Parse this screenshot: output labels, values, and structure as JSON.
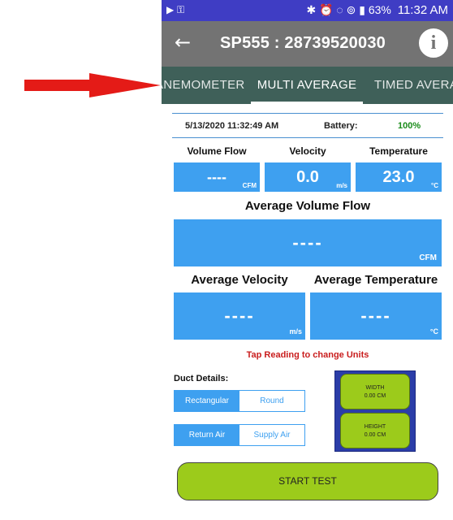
{
  "status_bar": {
    "time": "11:32 AM",
    "battery": "63%",
    "left_icons": "▶ ⚿",
    "right_icons": "✱ ⏰ ◌ ⊚ ▮"
  },
  "app_bar": {
    "title": "SP555 : 28739520030",
    "back_icon": "arrow-left-icon",
    "info_icon": "i"
  },
  "tabs": [
    {
      "label": "ANEMOMETER"
    },
    {
      "label": "MULTI AVERAGE",
      "selected": true
    },
    {
      "label": "TIMED AVERAGE"
    }
  ],
  "info": {
    "datetime": "5/13/2020 11:32:49 AM",
    "battery_label": "Battery:",
    "battery_value": "100%",
    "battery_color": "#1a8c1a"
  },
  "readings": [
    {
      "label": "Volume Flow",
      "value": "----",
      "unit": "CFM"
    },
    {
      "label": "Velocity",
      "value": "0.0",
      "unit": "m/s"
    },
    {
      "label": "Temperature",
      "value": "23.0",
      "unit": "°C"
    }
  ],
  "avg_volume_flow": {
    "label": "Average Volume Flow",
    "value": "----",
    "unit": "CFM"
  },
  "avg_velocity": {
    "label": "Average Velocity",
    "value": "----",
    "unit": "m/s"
  },
  "avg_temperature": {
    "label": "Average Temperature",
    "value": "----",
    "unit": "°C"
  },
  "hint": "Tap Reading to change Units",
  "duct": {
    "label": "Duct Details:",
    "shape_options": [
      "Rectangular",
      "Round"
    ],
    "shape_selected": "Rectangular",
    "air_options": [
      "Return Air",
      "Supply Air"
    ],
    "air_selected": "Return Air"
  },
  "dimensions": {
    "width_label": "WIDTH",
    "width_value": "0.00 CM",
    "height_label": "HEIGHT",
    "height_value": "0.00 CM"
  },
  "start_button": "START TEST",
  "colors": {
    "accent_blue": "#3ea0f0",
    "start_green": "#9ccb1b",
    "hint_red": "#c91d1d",
    "tab_bg": "#3f6059"
  }
}
